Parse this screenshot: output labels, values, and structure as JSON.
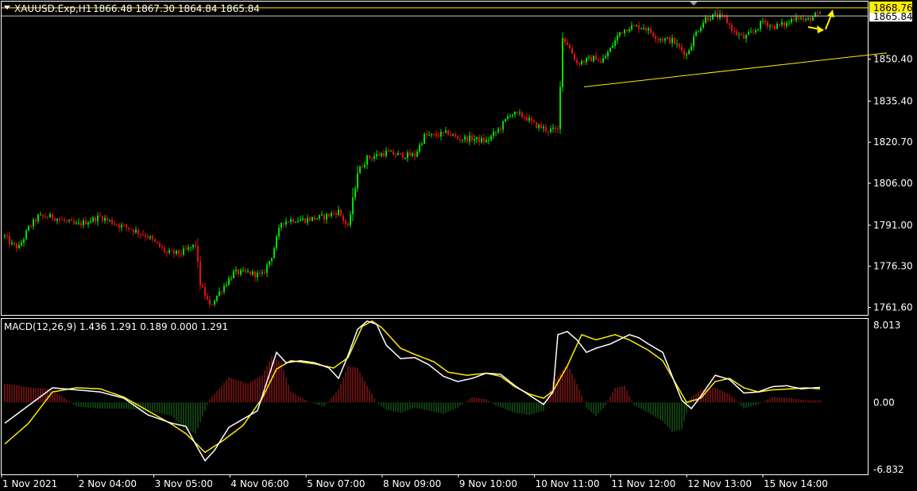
{
  "header": {
    "symbol_label": "XAUUSD.Exp,H1",
    "ohlc_text": "1866.48 1867.30 1864.84 1865.84"
  },
  "price_panel": {
    "y_ticks": [
      "1850.40",
      "1835.40",
      "1820.70",
      "1806.00",
      "1791.00",
      "1776.30",
      "1761.60"
    ],
    "current_price_label": "1868.76",
    "bid_price_label": "1865.84"
  },
  "macd_panel": {
    "title": "MACD(12,26,9) 1.436 1.291 0.189 0.000 1.291",
    "y_ticks": [
      "8.013",
      "0.00",
      "-6.832"
    ]
  },
  "x_axis": {
    "ticks": [
      "1 Nov 2021",
      "2 Nov 04:00",
      "3 Nov 05:00",
      "4 Nov 06:00",
      "5 Nov 07:00",
      "8 Nov 09:00",
      "9 Nov 10:00",
      "10 Nov 11:00",
      "11 Nov 12:00",
      "12 Nov 13:00",
      "15 Nov 14:00"
    ]
  },
  "colors": {
    "background": "#000000",
    "bull_candle": "#00e000",
    "bear_candle": "#e01010",
    "text": "#ffffff",
    "grid_line": "#ffffff",
    "macd_line": "#ffffff",
    "signal_line": "#ffee00",
    "hist_positive": "#c02020",
    "hist_negative": "#1e7a1e",
    "annotation": "#ffee00"
  },
  "chart_data": [
    {
      "type": "candlestick",
      "symbol": "XAUUSD.Exp",
      "timeframe": "H1",
      "ylim": [
        1758.9,
        1871.0
      ],
      "anchors": [
        [
          0,
          1787
        ],
        [
          3,
          1784
        ],
        [
          6,
          1783
        ],
        [
          10,
          1790
        ],
        [
          14,
          1794
        ],
        [
          20,
          1794
        ],
        [
          30,
          1791
        ],
        [
          40,
          1794
        ],
        [
          48,
          1791
        ],
        [
          52,
          1790
        ],
        [
          60,
          1787
        ],
        [
          68,
          1781
        ],
        [
          74,
          1781
        ],
        [
          80,
          1784
        ],
        [
          82,
          1770
        ],
        [
          86,
          1762
        ],
        [
          90,
          1767
        ],
        [
          96,
          1774
        ],
        [
          102,
          1774
        ],
        [
          108,
          1773
        ],
        [
          112,
          1780
        ],
        [
          116,
          1792
        ],
        [
          120,
          1793
        ],
        [
          126,
          1793
        ],
        [
          134,
          1794
        ],
        [
          140,
          1796
        ],
        [
          144,
          1790
        ],
        [
          148,
          1810
        ],
        [
          152,
          1815
        ],
        [
          156,
          1816
        ],
        [
          160,
          1817
        ],
        [
          166,
          1816
        ],
        [
          172,
          1816
        ],
        [
          176,
          1823
        ],
        [
          180,
          1823
        ],
        [
          186,
          1824
        ],
        [
          190,
          1822
        ],
        [
          196,
          1822
        ],
        [
          202,
          1821
        ],
        [
          208,
          1826
        ],
        [
          212,
          1831
        ],
        [
          218,
          1830
        ],
        [
          222,
          1827
        ],
        [
          228,
          1825
        ],
        [
          232,
          1825
        ],
        [
          234,
          1858
        ],
        [
          236,
          1856
        ],
        [
          240,
          1849
        ],
        [
          244,
          1850
        ],
        [
          248,
          1851
        ],
        [
          250,
          1849
        ],
        [
          254,
          1854
        ],
        [
          258,
          1860
        ],
        [
          262,
          1862
        ],
        [
          268,
          1862
        ],
        [
          274,
          1858
        ],
        [
          280,
          1857
        ],
        [
          286,
          1852
        ],
        [
          290,
          1860
        ],
        [
          294,
          1865
        ],
        [
          298,
          1866
        ],
        [
          302,
          1865
        ],
        [
          306,
          1860
        ],
        [
          310,
          1858
        ],
        [
          314,
          1860
        ],
        [
          318,
          1864
        ],
        [
          322,
          1862
        ],
        [
          328,
          1863
        ],
        [
          332,
          1866
        ],
        [
          336,
          1864
        ],
        [
          340,
          1866
        ],
        [
          342,
          1866
        ]
      ],
      "trendline": {
        "start": [
          243,
          1840.5
        ],
        "end": [
          350,
          1851.5
        ]
      },
      "horizontal_levels": [
        1868.76,
        1865.84
      ]
    },
    {
      "type": "macd",
      "params": "12,26,9",
      "ylim": [
        -6.832,
        8.013
      ],
      "macd": [
        [
          0,
          -2.0
        ],
        [
          10,
          -0.3
        ],
        [
          20,
          1.4
        ],
        [
          30,
          1.2
        ],
        [
          40,
          1.0
        ],
        [
          50,
          0.4
        ],
        [
          60,
          -1.2
        ],
        [
          70,
          -2.0
        ],
        [
          76,
          -2.3
        ],
        [
          80,
          -4.0
        ],
        [
          84,
          -5.6
        ],
        [
          88,
          -4.6
        ],
        [
          94,
          -2.4
        ],
        [
          100,
          -1.6
        ],
        [
          106,
          -0.8
        ],
        [
          110,
          2.0
        ],
        [
          114,
          4.8
        ],
        [
          118,
          3.8
        ],
        [
          124,
          4.0
        ],
        [
          130,
          3.8
        ],
        [
          136,
          3.3
        ],
        [
          140,
          2.3
        ],
        [
          144,
          4.5
        ],
        [
          148,
          7.0
        ],
        [
          152,
          7.8
        ],
        [
          156,
          7.5
        ],
        [
          160,
          5.5
        ],
        [
          166,
          4.2
        ],
        [
          172,
          4.3
        ],
        [
          178,
          3.6
        ],
        [
          184,
          2.5
        ],
        [
          190,
          2.0
        ],
        [
          196,
          2.3
        ],
        [
          202,
          2.8
        ],
        [
          208,
          2.7
        ],
        [
          214,
          1.6
        ],
        [
          220,
          0.7
        ],
        [
          226,
          -0.2
        ],
        [
          230,
          1.0
        ],
        [
          232,
          6.5
        ],
        [
          236,
          6.8
        ],
        [
          240,
          6.0
        ],
        [
          244,
          4.8
        ],
        [
          248,
          5.2
        ],
        [
          254,
          5.6
        ],
        [
          262,
          6.5
        ],
        [
          266,
          6.2
        ],
        [
          270,
          5.6
        ],
        [
          276,
          4.8
        ],
        [
          280,
          2.5
        ],
        [
          284,
          0.2
        ],
        [
          288,
          -0.6
        ],
        [
          292,
          0.6
        ],
        [
          298,
          2.6
        ],
        [
          304,
          2.2
        ],
        [
          310,
          0.9
        ],
        [
          316,
          1.0
        ],
        [
          322,
          1.5
        ],
        [
          328,
          1.6
        ],
        [
          334,
          1.3
        ],
        [
          342,
          1.436
        ]
      ],
      "signal": [
        [
          0,
          -4.0
        ],
        [
          10,
          -2.0
        ],
        [
          20,
          1.0
        ],
        [
          30,
          1.4
        ],
        [
          40,
          1.3
        ],
        [
          50,
          0.5
        ],
        [
          60,
          -0.8
        ],
        [
          70,
          -2.1
        ],
        [
          76,
          -3.0
        ],
        [
          84,
          -4.8
        ],
        [
          92,
          -3.6
        ],
        [
          100,
          -2.2
        ],
        [
          108,
          0.4
        ],
        [
          114,
          3.2
        ],
        [
          120,
          4.0
        ],
        [
          130,
          3.7
        ],
        [
          138,
          3.3
        ],
        [
          144,
          4.3
        ],
        [
          150,
          7.3
        ],
        [
          154,
          7.8
        ],
        [
          158,
          7.2
        ],
        [
          166,
          5.2
        ],
        [
          172,
          4.6
        ],
        [
          180,
          3.9
        ],
        [
          186,
          2.9
        ],
        [
          194,
          2.6
        ],
        [
          202,
          2.8
        ],
        [
          208,
          2.5
        ],
        [
          214,
          1.5
        ],
        [
          220,
          0.8
        ],
        [
          226,
          0.4
        ],
        [
          230,
          1.1
        ],
        [
          236,
          3.5
        ],
        [
          242,
          6.5
        ],
        [
          248,
          6.0
        ],
        [
          256,
          6.5
        ],
        [
          262,
          6.0
        ],
        [
          270,
          5.0
        ],
        [
          276,
          4.0
        ],
        [
          282,
          1.6
        ],
        [
          286,
          0.0
        ],
        [
          292,
          0.4
        ],
        [
          298,
          2.0
        ],
        [
          304,
          2.3
        ],
        [
          310,
          1.4
        ],
        [
          316,
          1.0
        ],
        [
          322,
          1.2
        ],
        [
          330,
          1.3
        ],
        [
          336,
          1.4
        ],
        [
          342,
          1.291
        ]
      ],
      "histogram_values": [
        [
          0,
          1.8
        ],
        [
          6,
          1.6
        ],
        [
          12,
          1.4
        ],
        [
          18,
          1.3
        ],
        [
          24,
          0.6
        ],
        [
          30,
          -0.4
        ],
        [
          40,
          -0.6
        ],
        [
          50,
          -0.6
        ],
        [
          60,
          -0.8
        ],
        [
          70,
          -1.3
        ],
        [
          76,
          -2.6
        ],
        [
          80,
          -3.0
        ],
        [
          86,
          0.3
        ],
        [
          94,
          2.4
        ],
        [
          102,
          1.8
        ],
        [
          108,
          2.6
        ],
        [
          112,
          4.4
        ],
        [
          116,
          3.8
        ],
        [
          120,
          1.0
        ],
        [
          128,
          0.0
        ],
        [
          134,
          -0.4
        ],
        [
          140,
          1.2
        ],
        [
          144,
          3.5
        ],
        [
          148,
          3.3
        ],
        [
          152,
          1.6
        ],
        [
          156,
          0.0
        ],
        [
          160,
          -0.7
        ],
        [
          166,
          -1.0
        ],
        [
          172,
          -0.5
        ],
        [
          178,
          -0.8
        ],
        [
          184,
          -1.1
        ],
        [
          190,
          -0.5
        ],
        [
          196,
          0.5
        ],
        [
          202,
          0.3
        ],
        [
          206,
          -0.3
        ],
        [
          214,
          -1.0
        ],
        [
          220,
          -1.2
        ],
        [
          226,
          -0.8
        ],
        [
          230,
          2.0
        ],
        [
          236,
          3.7
        ],
        [
          240,
          1.8
        ],
        [
          244,
          -0.5
        ],
        [
          248,
          -1.3
        ],
        [
          252,
          -0.3
        ],
        [
          256,
          1.4
        ],
        [
          260,
          1.6
        ],
        [
          264,
          -0.3
        ],
        [
          270,
          -1.0
        ],
        [
          276,
          -1.8
        ],
        [
          280,
          -2.8
        ],
        [
          284,
          -2.6
        ],
        [
          288,
          0.5
        ],
        [
          292,
          1.2
        ],
        [
          298,
          1.4
        ],
        [
          304,
          0.8
        ],
        [
          310,
          -0.6
        ],
        [
          316,
          -0.2
        ],
        [
          322,
          0.5
        ],
        [
          330,
          0.4
        ],
        [
          336,
          0.2
        ],
        [
          342,
          0.189
        ]
      ]
    }
  ]
}
